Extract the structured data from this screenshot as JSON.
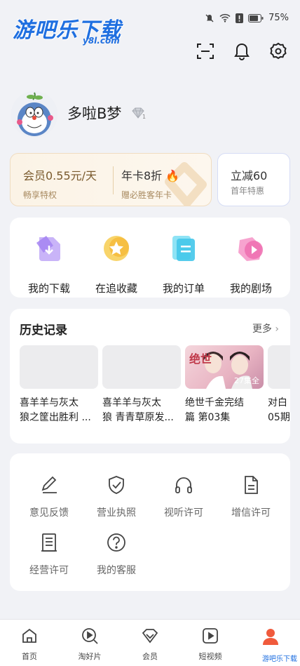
{
  "status_bar": {
    "battery": "75%"
  },
  "watermark": {
    "main": "游吧乐下载",
    "sub": "y8l.com",
    "corner": "游吧乐下载"
  },
  "top_icons": [
    "scan-icon",
    "bell-icon",
    "gear-icon"
  ],
  "profile": {
    "name": "多啦B梦",
    "badge_count": "1"
  },
  "vip": {
    "left_title": "会员0.55元/天",
    "left_sub": "畅享特权",
    "right_title": "年卡8折",
    "right_sub": "赠必胜客年卡"
  },
  "promo": {
    "title": "立减60",
    "sub": "首年特惠"
  },
  "quick_actions": [
    {
      "label": "我的下载",
      "icon": "download-icon",
      "color": "#b99af5"
    },
    {
      "label": "在追收藏",
      "icon": "star-icon",
      "color": "#f7c64a"
    },
    {
      "label": "我的订单",
      "icon": "order-icon",
      "color": "#5fd3f0"
    },
    {
      "label": "我的剧场",
      "icon": "play-icon",
      "color": "#f07ab8"
    }
  ],
  "history": {
    "title": "历史记录",
    "more": "更多",
    "items": [
      {
        "line1": "喜羊羊与灰太",
        "line2": "狼之筐出胜利 ..."
      },
      {
        "line1": "喜羊羊与灰太",
        "line2": "狼 青青草原发..."
      },
      {
        "line1": "绝世千金完结",
        "line2": "篇 第03集",
        "episodes": "27集全",
        "poster_text": "绝世"
      },
      {
        "line1": "对白",
        "line2": "05期"
      }
    ]
  },
  "tools": [
    {
      "label": "意见反馈",
      "icon": "pen-icon"
    },
    {
      "label": "营业执照",
      "icon": "shield-check-icon"
    },
    {
      "label": "视听许可",
      "icon": "headphones-icon"
    },
    {
      "label": "增信许可",
      "icon": "document-icon"
    },
    {
      "label": "经营许可",
      "icon": "ledger-icon"
    },
    {
      "label": "我的客服",
      "icon": "help-icon"
    }
  ],
  "nav": [
    {
      "label": "首页",
      "icon": "home-icon"
    },
    {
      "label": "淘好片",
      "icon": "discover-icon"
    },
    {
      "label": "会员",
      "icon": "vip-icon"
    },
    {
      "label": "短视频",
      "icon": "video-icon"
    },
    {
      "label": "",
      "icon": "profile-icon",
      "active": true
    }
  ],
  "colors": {
    "accent": "#f05a3c",
    "brand_blue": "#1f6fe0",
    "vip_text": "#7a5a2d"
  }
}
